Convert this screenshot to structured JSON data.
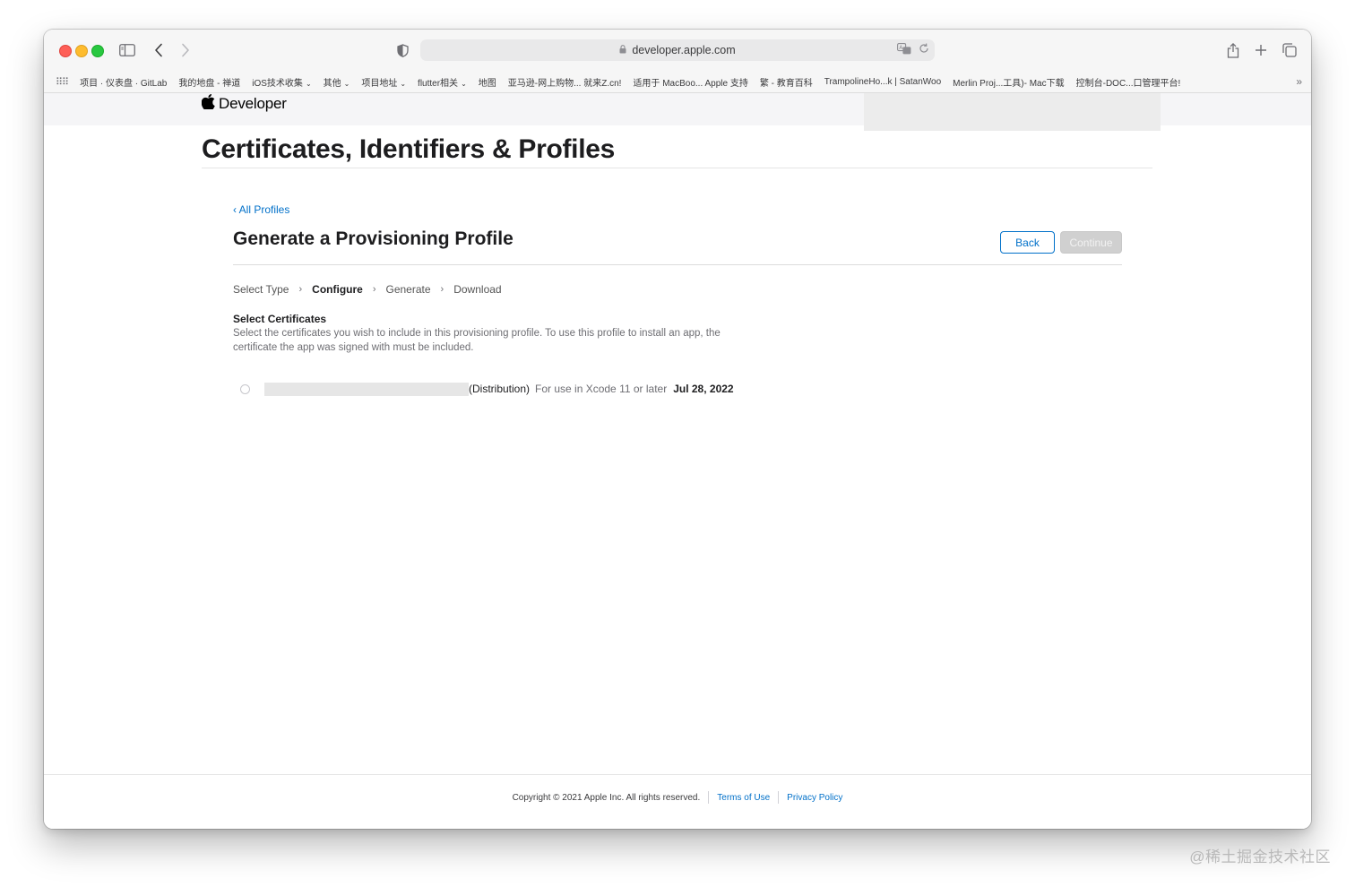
{
  "browser": {
    "url": "developer.apple.com",
    "bookmarks": [
      "项目 · 仪表盘 · GitLab",
      "我的地盘 - 禅道",
      "iOS技术收集",
      "其他",
      "项目地址",
      "flutter相关",
      "地图",
      "亚马逊-网上购物... 就来Z.cn!",
      "适用于 MacBoo... Apple 支持",
      "繁 - 教育百科",
      "TrampolineHo...k | SatanWoo",
      "Merlin Proj...工具)- Mac下载",
      "控制台-DOC...口管理平台!"
    ],
    "bookmark_dropdowns": [
      false,
      false,
      true,
      true,
      true,
      true,
      false,
      false,
      false,
      false,
      false,
      false,
      false
    ]
  },
  "nav": {
    "brand": "Developer"
  },
  "header": {
    "title": "Certificates, Identifiers & Profiles"
  },
  "main": {
    "back_link": "‹ All Profiles",
    "title": "Generate a Provisioning Profile",
    "back_button": "Back",
    "continue_button": "Continue",
    "steps": [
      "Select Type",
      "Configure",
      "Generate",
      "Download"
    ],
    "active_step": 1,
    "section_title": "Select Certificates",
    "section_desc": "Select the certificates you wish to include in this provisioning profile. To use this profile to install an app, the certificate the app was signed with must be included.",
    "certificate": {
      "type": "(Distribution)",
      "note": "For use in Xcode 11 or later",
      "date": "Jul 28, 2022"
    }
  },
  "footer": {
    "copyright": "Copyright © 2021 Apple Inc. All rights reserved.",
    "terms": "Terms of Use",
    "privacy": "Privacy Policy"
  },
  "watermark": "@稀土掘金技术社区",
  "colors": {
    "link": "#0070c9",
    "primary_text": "#1d1d1f",
    "secondary_text": "#6e6e73"
  }
}
